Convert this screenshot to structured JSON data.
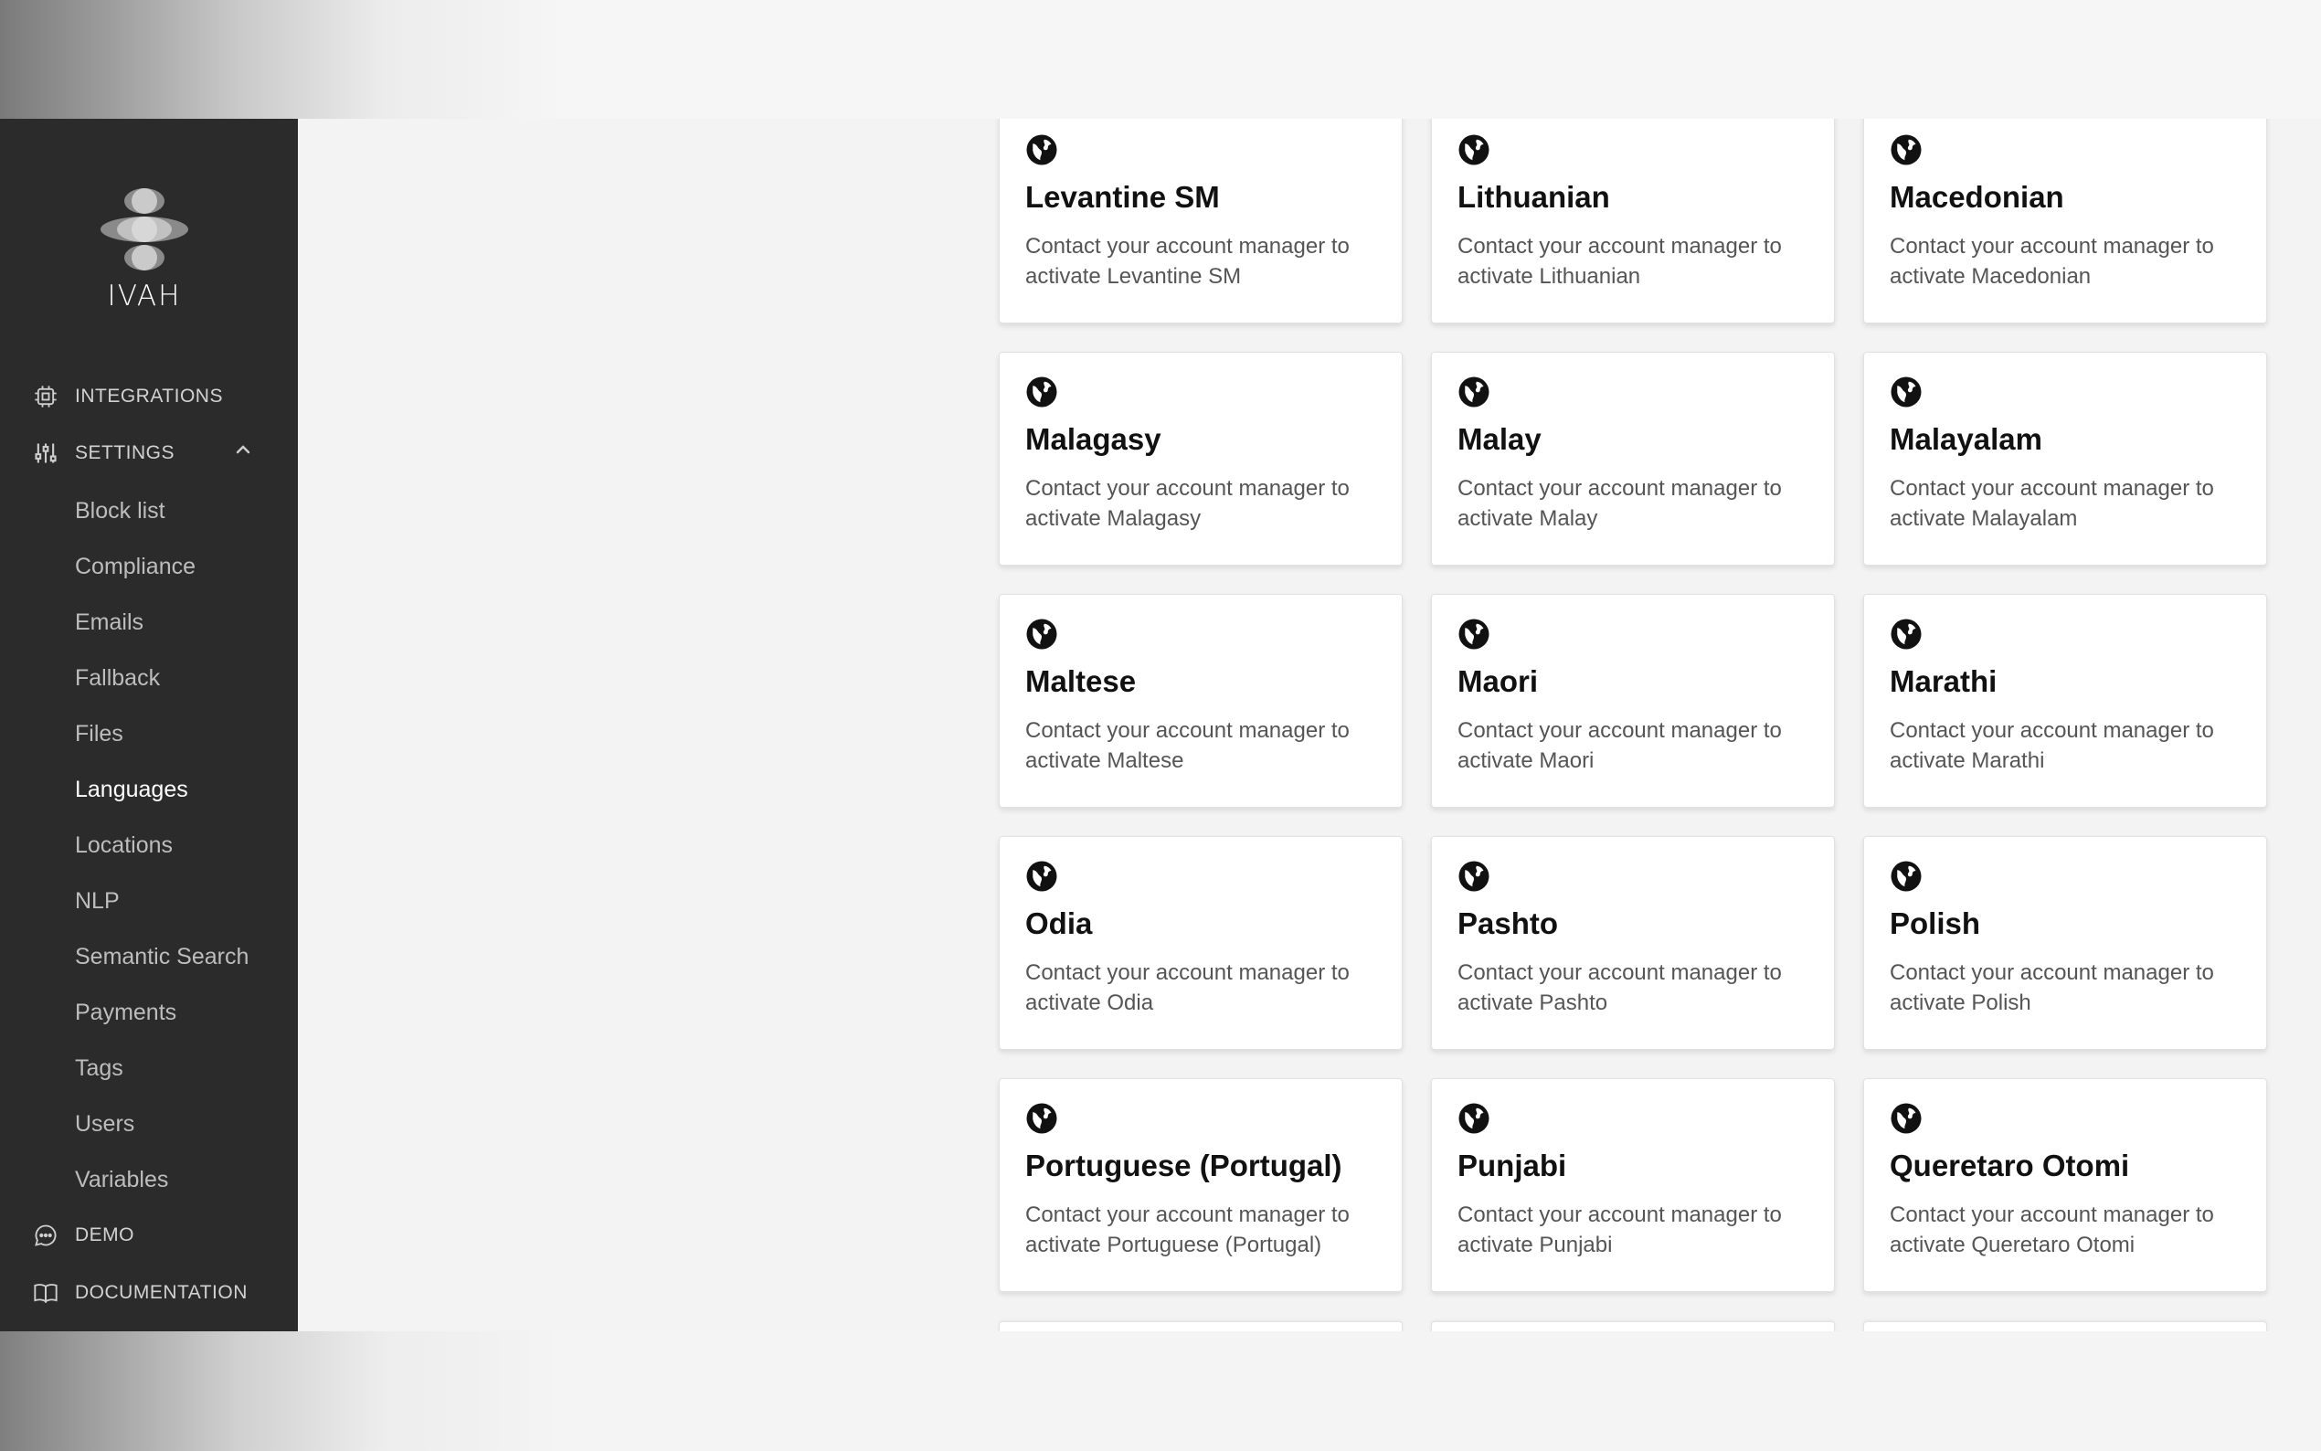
{
  "sidebar": {
    "brand": "IVAH",
    "nav": {
      "integrations": "INTEGRATIONS",
      "settings": "SETTINGS",
      "demo": "DEMO",
      "documentation": "DOCUMENTATION"
    },
    "settings_items": [
      "Block list",
      "Compliance",
      "Emails",
      "Fallback",
      "Files",
      "Languages",
      "Locations",
      "NLP",
      "Semantic Search",
      "Payments",
      "Tags",
      "Users",
      "Variables"
    ],
    "active_item": "Languages"
  },
  "languages": [
    {
      "name": "Levantine SM",
      "description": "Contact your account manager to activate Levantine SM"
    },
    {
      "name": "Lithuanian",
      "description": "Contact your account manager to activate Lithuanian"
    },
    {
      "name": "Macedonian",
      "description": "Contact your account manager to activate Macedonian"
    },
    {
      "name": "Malagasy",
      "description": "Contact your account manager to activate Malagasy"
    },
    {
      "name": "Malay",
      "description": "Contact your account manager to activate Malay"
    },
    {
      "name": "Malayalam",
      "description": "Contact your account manager to activate Malayalam"
    },
    {
      "name": "Maltese",
      "description": "Contact your account manager to activate Maltese"
    },
    {
      "name": "Maori",
      "description": "Contact your account manager to activate Maori"
    },
    {
      "name": "Marathi",
      "description": "Contact your account manager to activate Marathi"
    },
    {
      "name": "Odia",
      "description": "Contact your account manager to activate Odia"
    },
    {
      "name": "Pashto",
      "description": "Contact your account manager to activate Pashto"
    },
    {
      "name": "Polish",
      "description": "Contact your account manager to activate Polish"
    },
    {
      "name": "Portuguese (Portugal)",
      "description": "Contact your account manager to activate Portuguese (Portugal)"
    },
    {
      "name": "Punjabi",
      "description": "Contact your account manager to activate Punjabi"
    },
    {
      "name": "Queretaro Otomi",
      "description": "Contact your account manager to activate Queretaro Otomi"
    }
  ],
  "icons": {
    "language": "globe-icon",
    "integrations": "chip-icon",
    "settings": "sliders-icon",
    "demo": "chat-icon",
    "documentation": "book-icon",
    "collapse": "chevron-up-icon"
  }
}
